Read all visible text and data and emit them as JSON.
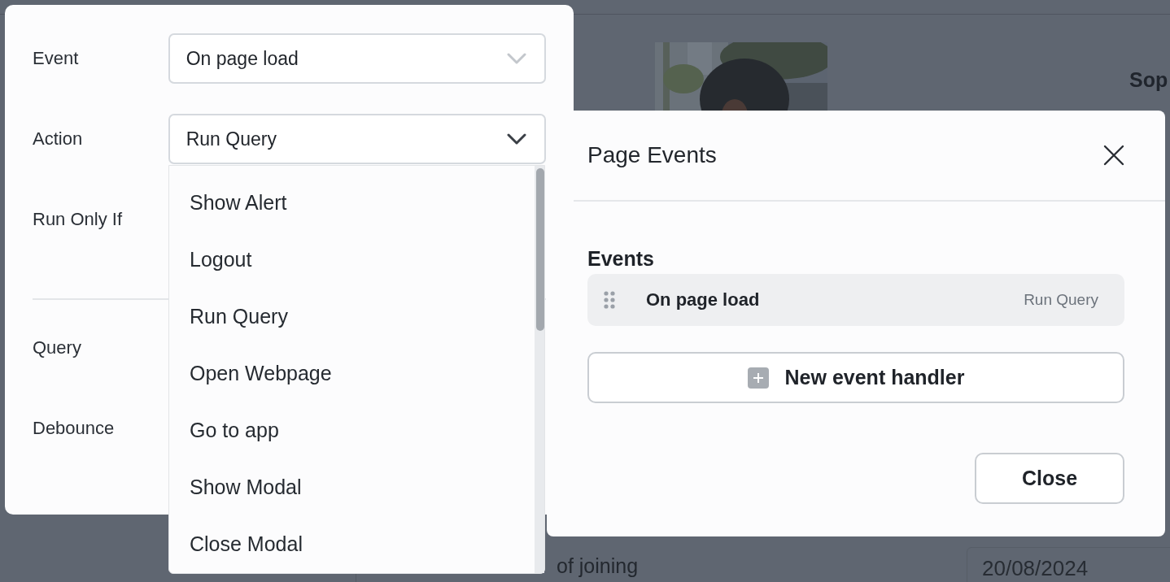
{
  "background": {
    "heading": "Sop",
    "field_label": "of joining",
    "date_field": {
      "value": "20/08/2024"
    }
  },
  "handler_panel": {
    "rows": [
      {
        "label": "Event",
        "select": {
          "value": "On page load",
          "expanded": false
        }
      },
      {
        "label": "Action",
        "select": {
          "value": "Run Query",
          "expanded": true
        }
      },
      {
        "label": "Run Only If"
      }
    ],
    "lower_rows": [
      {
        "label": "Query"
      },
      {
        "label": "Debounce"
      }
    ]
  },
  "action_dropdown": {
    "options": [
      "Show Alert",
      "Logout",
      "Run Query",
      "Open Webpage",
      "Go to app",
      "Show Modal",
      "Close Modal"
    ]
  },
  "page_events": {
    "title": "Page Events",
    "section": "Events",
    "events": [
      {
        "event": "On page load",
        "action": "Run Query"
      }
    ],
    "add_button": "New event handler",
    "close_button": "Close"
  }
}
